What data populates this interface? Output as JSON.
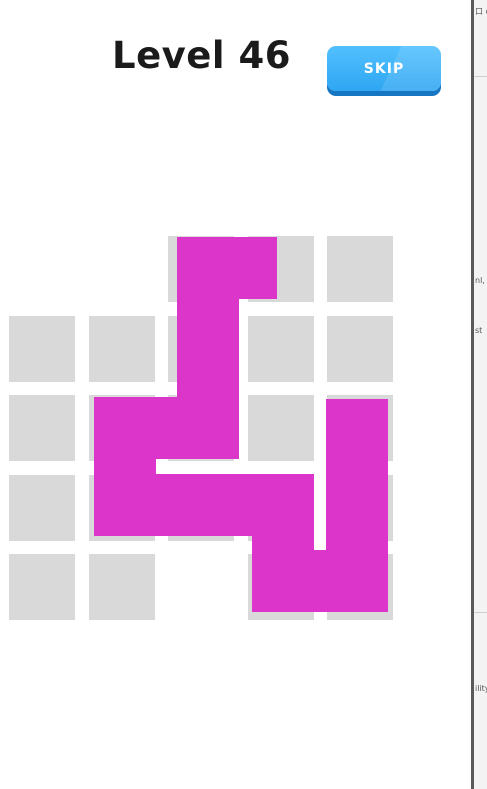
{
  "header": {
    "title": "Level 46",
    "skip_label": "SKIP"
  },
  "board": {
    "columns": 5,
    "rows": 5,
    "path_color": "#dc35c9",
    "empty_cell_color": "#d9d9d9",
    "blank_cells": [
      [
        0,
        0
      ],
      [
        0,
        1
      ],
      [
        4,
        2
      ]
    ]
  },
  "side_panel": {
    "snippets": [
      "口 c",
      "nl, i",
      "st",
      "ility"
    ]
  }
}
